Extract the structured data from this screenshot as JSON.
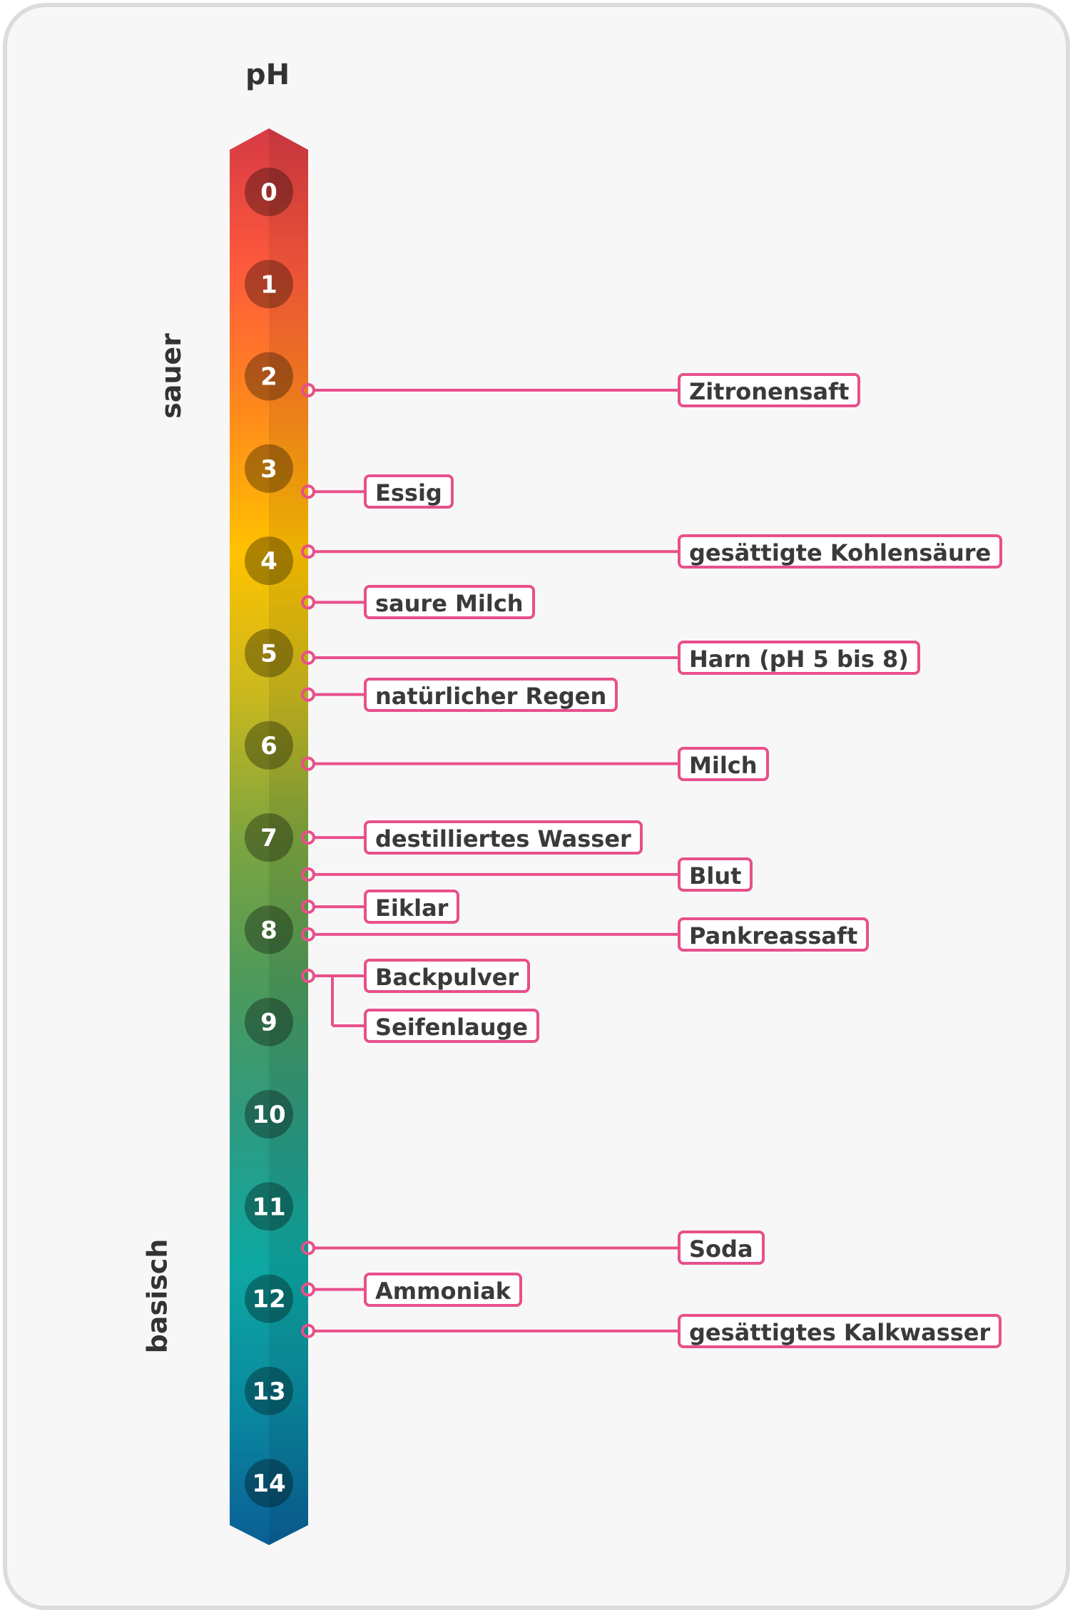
{
  "title": "pH",
  "side_labels": {
    "acid": "sauer",
    "base": "basisch"
  },
  "scale": {
    "min": 0,
    "max": 14,
    "ticks": [
      "0",
      "1",
      "2",
      "3",
      "4",
      "5",
      "6",
      "7",
      "8",
      "9",
      "10",
      "11",
      "12",
      "13",
      "14"
    ],
    "gradient_colors": [
      "#d63a44",
      "#ff5a3c",
      "#ff8a1c",
      "#ffc200",
      "#c9b81e",
      "#7ea53f",
      "#4e9a5a",
      "#2e9a80",
      "#0ea8a2",
      "#0a8aa0",
      "#0a5f96"
    ]
  },
  "substances": [
    {
      "name": "Zitronensaft",
      "ph": 2.15,
      "side": "far"
    },
    {
      "name": "Essig",
      "ph": 3.25,
      "side": "near"
    },
    {
      "name": "gesättigte Kohlensäure",
      "ph": 3.9,
      "side": "far"
    },
    {
      "name": "saure Milch",
      "ph": 4.45,
      "side": "near"
    },
    {
      "name": "Harn (pH 5 bis 8)",
      "ph": 5.05,
      "side": "far"
    },
    {
      "name": "natürlicher Regen",
      "ph": 5.45,
      "side": "near"
    },
    {
      "name": "Milch",
      "ph": 6.2,
      "side": "far"
    },
    {
      "name": "destilliertes Wasser",
      "ph": 7.0,
      "side": "near"
    },
    {
      "name": "Blut",
      "ph": 7.4,
      "side": "far"
    },
    {
      "name": "Eiklar",
      "ph": 7.75,
      "side": "near"
    },
    {
      "name": "Pankreassaft",
      "ph": 8.05,
      "side": "far"
    },
    {
      "name": "Backpulver",
      "ph": 8.5,
      "side": "near-branch"
    },
    {
      "name": "Seifenlauge",
      "ph": 8.5,
      "side": "near-branch"
    },
    {
      "name": "Soda",
      "ph": 11.45,
      "side": "far"
    },
    {
      "name": "Ammoniak",
      "ph": 11.9,
      "side": "near"
    },
    {
      "name": "gesättigtes Kalkwasser",
      "ph": 12.35,
      "side": "far"
    }
  ],
  "colors": {
    "connector": "#e8508a",
    "label_text": "#3a3a3a",
    "tick_circle": "rgba(0,0,0,0.32)"
  }
}
